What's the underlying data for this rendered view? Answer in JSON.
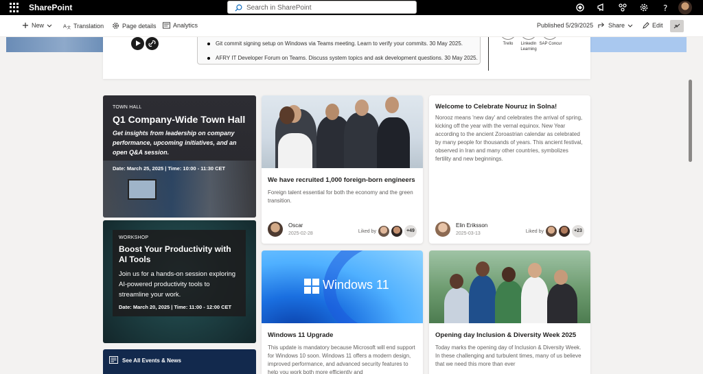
{
  "suite": {
    "app_name": "SharePoint",
    "search_placeholder": "Search in SharePoint"
  },
  "command_bar": {
    "new_label": "New",
    "translation_label": "Translation",
    "page_details_label": "Page details",
    "analytics_label": "Analytics",
    "published_label": "Published 5/29/2025",
    "share_label": "Share",
    "edit_label": "Edit"
  },
  "top_panel": {
    "news_items": [
      "Git commit signing setup on Windows via Teams meeting. Learn to verify your commits. 30 May 2025.",
      "AFRY IT Developer Forum on Teams. Discuss system topics and ask development questions. 30 May 2025."
    ],
    "apps": [
      {
        "label": "Trello"
      },
      {
        "label": "LinkedIn Learning"
      },
      {
        "label": "SAP Concur"
      }
    ]
  },
  "events": [
    {
      "tag": "TOWN HALL",
      "title": "Q1 Company-Wide Town Hall",
      "description": "Get insights from leadership on company performance, upcoming initiatives, and an open Q&A session.",
      "date": "Date: March 25, 2025 | Time: 10:00 - 11:30 CET"
    },
    {
      "tag": "WORKSHOP",
      "title": "Boost Your Productivity with AI Tools",
      "description": "Join us for a hands-on session exploring AI-powered productivity tools to streamline your work.",
      "date": "Date: March 20, 2025 | Time: 11:00 - 12:00 CET"
    }
  ],
  "see_all_label": "See All Events & News",
  "news": [
    {
      "title": "We have recruited 1,000 foreign-born engineers",
      "description": "Foreign talent essential for both the economy and the green transition.",
      "author": "Oscar",
      "date": "2025-02-28",
      "liked_by": "Liked by",
      "likes_extra": "+49"
    },
    {
      "title": "Welcome to Celebrate Nouruz in Solna!",
      "description": "Norooz means 'new day' and celebrates the arrival of spring, kicking off the year with the vernal equinox. New Year according to the ancient Zoroastrian calendar as celebrated by many people for thousands of years. This ancient festival, observed in Iran and many other countries, symbolizes fertility and new beginnings.",
      "author": "Elin Eriksson",
      "date": "2025-03-13",
      "liked_by": "Liked by",
      "likes_extra": "+23"
    },
    {
      "title": "Windows 11 Upgrade",
      "image_text": "Windows 11",
      "description": "This update is mandatory because Microsoft will end support for Windows 10 soon. Windows 11 offers a modern design, improved performance, and advanced security features to help you work both more efficiently and"
    },
    {
      "title": "Opening day Inclusion & Diversity Week 2025",
      "description": "Today marks the opening day of Inclusion & Diversity Week. In these challenging and turbulent times, many of us believe that we need this more than ever"
    }
  ]
}
